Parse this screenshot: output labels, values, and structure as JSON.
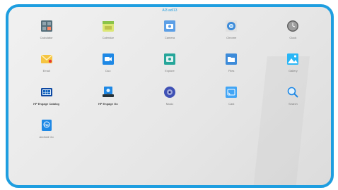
{
  "status_bar": {
    "text": "Al3 ad/13"
  },
  "apps": [
    {
      "label": "Calculator",
      "icon": "calculator-icon"
    },
    {
      "label": "Calendar",
      "icon": "calendar-icon"
    },
    {
      "label": "Camera",
      "icon": "camera-icon"
    },
    {
      "label": "Chrome",
      "icon": "chrome-icon"
    },
    {
      "label": "Clock",
      "icon": "clock-icon"
    },
    {
      "label": "Email",
      "icon": "email-icon"
    },
    {
      "label": "Duo",
      "icon": "duo-icon"
    },
    {
      "label": "Explore",
      "icon": "explore-icon"
    },
    {
      "label": "Files",
      "icon": "files-icon"
    },
    {
      "label": "Gallery",
      "icon": "gallery-icon"
    },
    {
      "label": "HP Engage Catalog",
      "icon": "engage-catalog-icon"
    },
    {
      "label": "HP Engage Go",
      "icon": "engage-go-icon"
    },
    {
      "label": "Music",
      "icon": "music-icon"
    },
    {
      "label": "Cast",
      "icon": "cast-icon"
    },
    {
      "label": "Search",
      "icon": "search-icon"
    },
    {
      "label": "Android Go",
      "icon": "hp-app-icon"
    }
  ]
}
